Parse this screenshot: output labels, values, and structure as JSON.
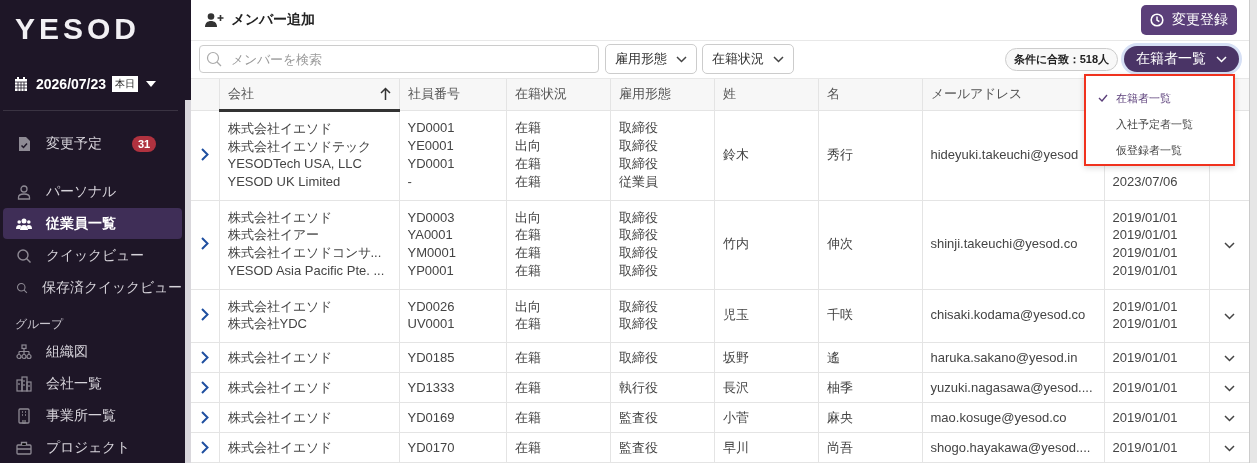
{
  "sidebar": {
    "logo": "YESOD",
    "date": "2026/07/23",
    "today_badge": "本日",
    "items": [
      {
        "kind": "schedule",
        "label": "変更予定",
        "badge": "31",
        "selected": false
      },
      {
        "kind": "person",
        "label": "パーソナル",
        "selected": false
      },
      {
        "kind": "people",
        "label": "従業員一覧",
        "selected": true
      },
      {
        "kind": "search",
        "label": "クイックビュー",
        "selected": false
      },
      {
        "kind": "search",
        "label": "保存済クイックビュー",
        "selected": false
      }
    ],
    "section_title": "グループ",
    "group_items": [
      {
        "kind": "org",
        "label": "組織図",
        "selected": false
      },
      {
        "kind": "building",
        "label": "会社一覧",
        "selected": false
      },
      {
        "kind": "office",
        "label": "事業所一覧",
        "selected": false
      },
      {
        "kind": "briefcase",
        "label": "プロジェクト",
        "selected": false
      }
    ]
  },
  "header": {
    "add_member": "メンバー追加",
    "register_change": "変更登録"
  },
  "filters": {
    "search_placeholder": "メンバーを検索",
    "dropdowns": [
      "雇用形態",
      "在籍状況"
    ],
    "match_count": "条件に合致：518人",
    "view": "在籍者一覧"
  },
  "view_menu": [
    {
      "label": "在籍者一覧",
      "selected": true
    },
    {
      "label": "入社予定者一覧",
      "selected": false
    },
    {
      "label": "仮登録者一覧",
      "selected": false
    }
  ],
  "table": {
    "columns": [
      {
        "label": "会社",
        "sorted": true
      },
      {
        "label": "社員番号",
        "sorted": false
      },
      {
        "label": "在籍状況",
        "sorted": false
      },
      {
        "label": "雇用形態",
        "sorted": false
      },
      {
        "label": "姓",
        "sorted": false
      },
      {
        "label": "名",
        "sorted": false
      },
      {
        "label": "メールアドレス",
        "sorted": false
      }
    ],
    "rows": [
      {
        "companies": [
          "株式会社イエソド",
          "株式会社イエソドテック",
          "YESODTech USA, LLC",
          "YESOD UK Limited"
        ],
        "ids": [
          "YD0001",
          "YE0001",
          "YD0001",
          "-"
        ],
        "statuses": [
          "在籍",
          "出向",
          "在籍",
          "在籍"
        ],
        "types": [
          "取締役",
          "取締役",
          "取締役",
          "従業員"
        ],
        "last": "鈴木",
        "first": "秀行",
        "email": "hideyuki.takeuchi@yesod",
        "dates": [
          "2023/07/06"
        ]
      },
      {
        "companies": [
          "株式会社イエソド",
          "株式会社イアー",
          "株式会社イエソドコンサ...",
          "YESOD Asia Pacific Pte. ..."
        ],
        "ids": [
          "YD0003",
          "YA0001",
          "YM0001",
          "YP0001"
        ],
        "statuses": [
          "出向",
          "在籍",
          "在籍",
          "在籍"
        ],
        "types": [
          "取締役",
          "取締役",
          "取締役",
          "取締役"
        ],
        "last": "竹内",
        "first": "伸次",
        "email": "shinji.takeuchi@yesod.co",
        "dates": [
          "2019/01/01",
          "2019/01/01",
          "2019/01/01",
          "2019/01/01"
        ]
      },
      {
        "companies": [
          "株式会社イエソド",
          "株式会社YDC"
        ],
        "ids": [
          "YD0026",
          "UV0001"
        ],
        "statuses": [
          "出向",
          "在籍"
        ],
        "types": [
          "取締役",
          "取締役"
        ],
        "last": "児玉",
        "first": "千咲",
        "email": "chisaki.kodama@yesod.co",
        "dates": [
          "2019/01/01",
          "2019/01/01"
        ]
      },
      {
        "companies": [
          "株式会社イエソド"
        ],
        "ids": [
          "YD0185"
        ],
        "statuses": [
          "在籍"
        ],
        "types": [
          "取締役"
        ],
        "last": "坂野",
        "first": "遙",
        "email": "haruka.sakano@yesod.in",
        "dates": [
          "2019/01/01"
        ]
      },
      {
        "companies": [
          "株式会社イエソド"
        ],
        "ids": [
          "YD1333"
        ],
        "statuses": [
          "在籍"
        ],
        "types": [
          "執行役"
        ],
        "last": "長沢",
        "first": "柚季",
        "email": "yuzuki.nagasawa@yesod....",
        "dates": [
          "2019/01/01"
        ]
      },
      {
        "companies": [
          "株式会社イエソド"
        ],
        "ids": [
          "YD0169"
        ],
        "statuses": [
          "在籍"
        ],
        "types": [
          "監査役"
        ],
        "last": "小菅",
        "first": "麻央",
        "email": "mao.kosuge@yesod.co",
        "dates": [
          "2019/01/01"
        ]
      },
      {
        "companies": [
          "株式会社イエソド"
        ],
        "ids": [
          "YD0170"
        ],
        "statuses": [
          "在籍"
        ],
        "types": [
          "監査役"
        ],
        "last": "早川",
        "first": "尚吾",
        "email": "shogo.hayakawa@yesod....",
        "dates": [
          "2019/01/01"
        ]
      }
    ]
  }
}
